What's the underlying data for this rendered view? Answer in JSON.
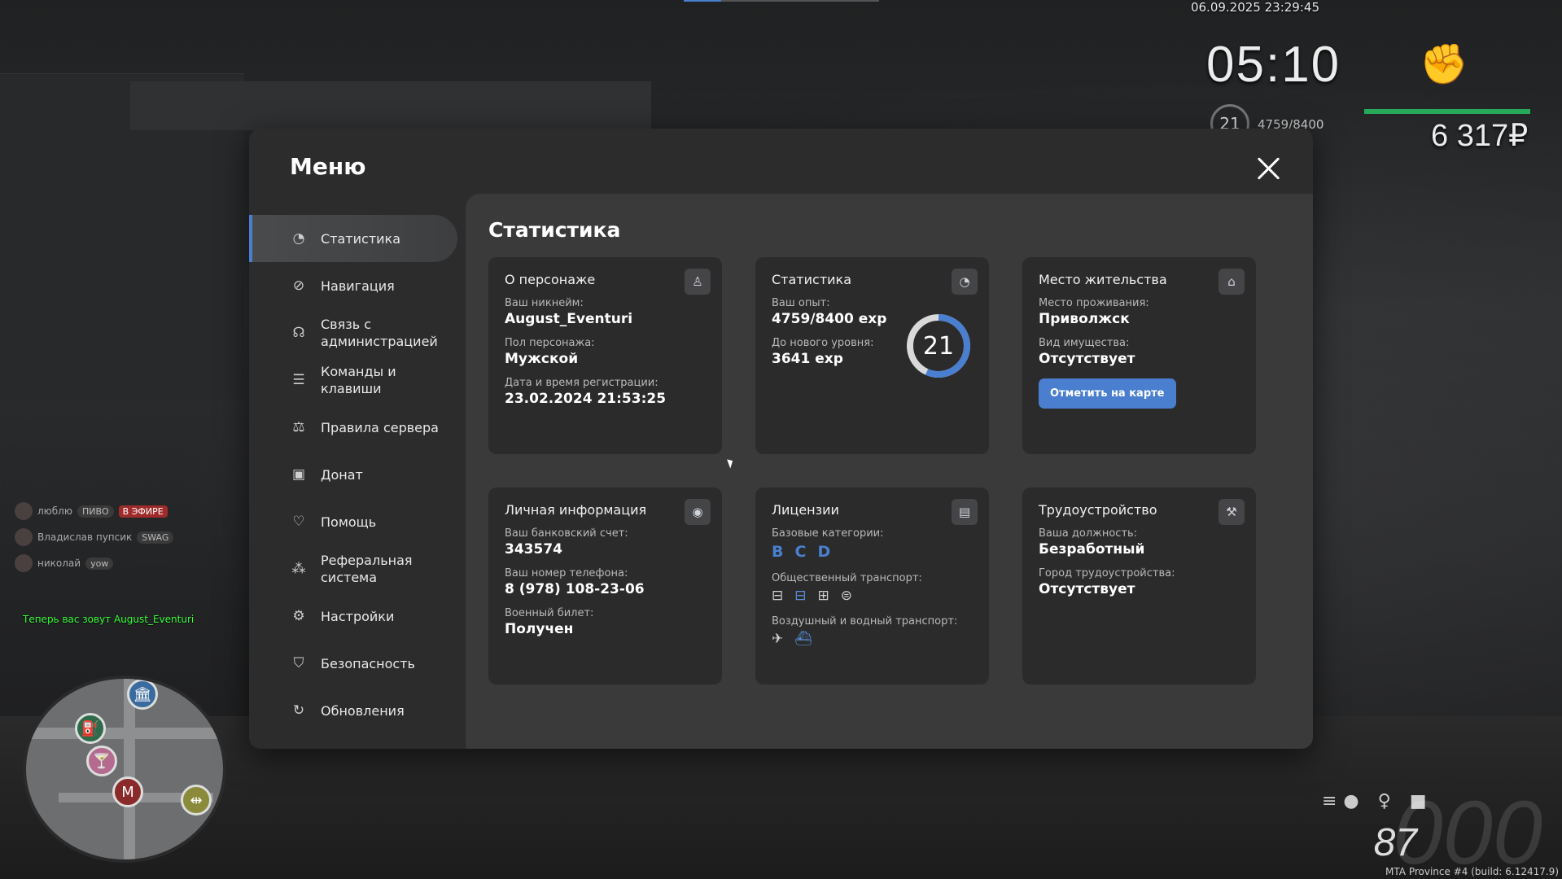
{
  "hud": {
    "datetime": "06.09.2025 23:29:45",
    "clock": "05:10",
    "level": "21",
    "exp": "4759/8400",
    "money": "6 317₽",
    "build": "MTA Province #4 (build: 6.12417.9)",
    "fuel": "87",
    "speed": "000",
    "colors": {
      "health": "#27a85a",
      "accent": "#4a7fd0"
    }
  },
  "chat": {
    "rows": [
      {
        "name": "люблю",
        "tag": "ПИВО",
        "live": "В ЭФИРЕ"
      },
      {
        "name": "Владислав пупсик",
        "tag": "SWAG",
        "live": ""
      },
      {
        "name": "николай",
        "tag": "yow",
        "live": ""
      }
    ],
    "system": "Теперь вас зовут August_Eventuri"
  },
  "menu": {
    "title": "Меню",
    "sidebar": [
      {
        "label": "Статистика",
        "icon": "pie-chart-icon",
        "active": true
      },
      {
        "label": "Навигация",
        "icon": "compass-icon"
      },
      {
        "label": "Связь с администрацией",
        "icon": "headset-icon"
      },
      {
        "label": "Команды и клавиши",
        "icon": "list-icon"
      },
      {
        "label": "Правила сервера",
        "icon": "scales-icon"
      },
      {
        "label": "Донат",
        "icon": "wallet-icon"
      },
      {
        "label": "Помощь",
        "icon": "heart-hand-icon"
      },
      {
        "label": "Реферальная система",
        "icon": "referral-icon"
      },
      {
        "label": "Настройки",
        "icon": "gear-icon"
      },
      {
        "label": "Безопасность",
        "icon": "shield-icon"
      },
      {
        "label": "Обновления",
        "icon": "refresh-icon"
      }
    ],
    "content_title": "Статистика",
    "cards": {
      "character": {
        "title": "О персонаже",
        "nickname_label": "Ваш никнейм:",
        "nickname": "August_Eventuri",
        "gender_label": "Пол персонажа:",
        "gender": "Мужской",
        "reg_label": "Дата и время регистрации:",
        "reg": "23.02.2024 21:53:25"
      },
      "stats": {
        "title": "Статистика",
        "exp_label": "Ваш опыт:",
        "exp": "4759/8400 exp",
        "next_label": "До нового уровня:",
        "next": "3641 exp",
        "level": "21",
        "progress": 0.5665
      },
      "residence": {
        "title": "Место жительства",
        "place_label": "Место проживания:",
        "place": "Приволжск",
        "property_label": "Вид имущества:",
        "property": "Отсутствует",
        "button": "Отметить на карте"
      },
      "personal": {
        "title": "Личная информация",
        "bank_label": "Ваш банковский счет:",
        "bank": "343574",
        "phone_label": "Ваш номер телефона:",
        "phone": "8 (978) 108-23-06",
        "military_label": "Военный билет:",
        "military": "Получен"
      },
      "licenses": {
        "title": "Лицензии",
        "base_label": "Базовые категории:",
        "base": [
          "B",
          "C",
          "D"
        ],
        "public_label": "Общественный транспорт:",
        "air_label": "Воздушный и водный транспорт:"
      },
      "employment": {
        "title": "Трудоустройство",
        "position_label": "Ваша должность:",
        "position": "Безработный",
        "city_label": "Город трудоустройства:",
        "city": "Отсутствует"
      }
    }
  }
}
